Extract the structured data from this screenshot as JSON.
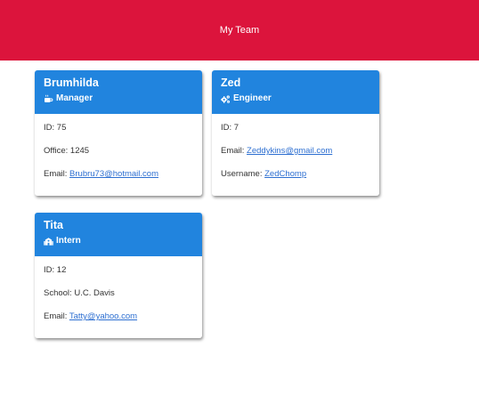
{
  "header": {
    "title": "My Team"
  },
  "team": [
    {
      "name": "Brumhilda",
      "role": "Manager",
      "role_icon": "mug-icon",
      "fields": [
        {
          "label": "ID: ",
          "value": "75"
        },
        {
          "label": "Office: ",
          "value": "1245"
        },
        {
          "label": "Email: ",
          "link": "Brubru73@hotmail.com"
        }
      ]
    },
    {
      "name": "Zed",
      "role": "Engineer",
      "role_icon": "cogs-icon",
      "fields": [
        {
          "label": "ID: ",
          "value": "7"
        },
        {
          "label": "Email: ",
          "link": "Zeddykins@gmail.com"
        },
        {
          "label": "Username: ",
          "link": "ZedChomp"
        }
      ]
    },
    {
      "name": "Tita",
      "role": "Intern",
      "role_icon": "school-icon",
      "fields": [
        {
          "label": "ID: ",
          "value": "12"
        },
        {
          "label": "School: ",
          "value": "U.C. Davis"
        },
        {
          "label": "Email: ",
          "link": "Tatty@yahoo.com"
        }
      ]
    }
  ],
  "colors": {
    "header": "#dc143c",
    "card_head": "#2184de",
    "link": "#2d6fd1"
  }
}
